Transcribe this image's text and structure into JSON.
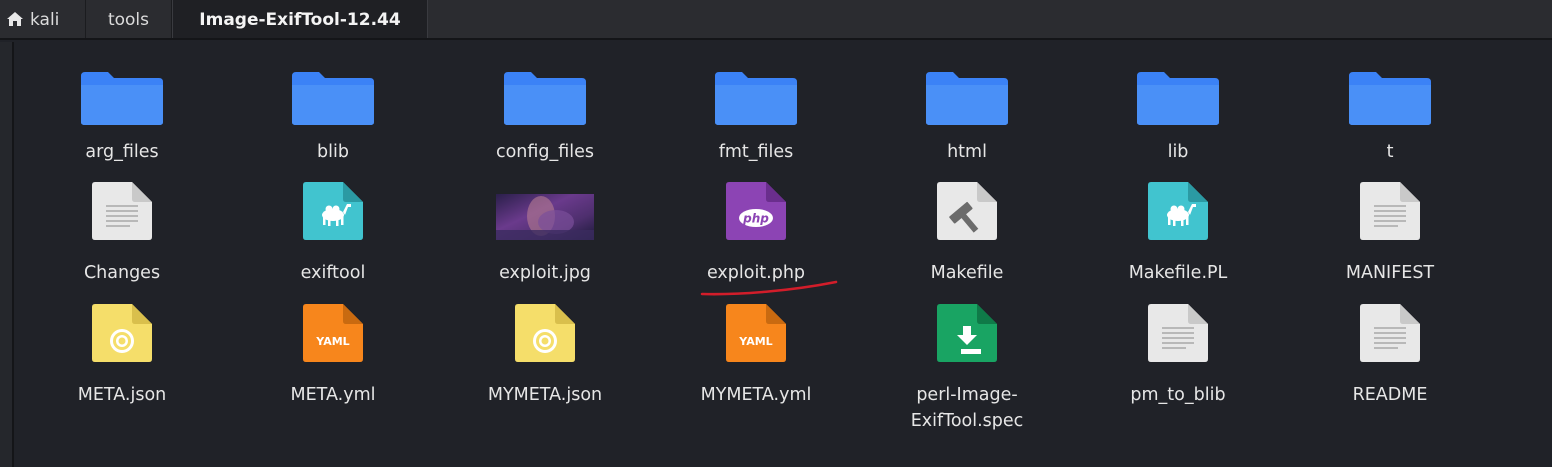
{
  "pathbar": {
    "crumbs": [
      {
        "label": "kali",
        "icon": "home-icon"
      },
      {
        "label": "tools"
      },
      {
        "label": "Image-ExifTool-12.44",
        "active": true
      }
    ]
  },
  "files": [
    {
      "name": "arg_files",
      "icon": "folder-icon"
    },
    {
      "name": "blib",
      "icon": "folder-icon"
    },
    {
      "name": "config_files",
      "icon": "folder-icon"
    },
    {
      "name": "fmt_files",
      "icon": "folder-icon"
    },
    {
      "name": "html",
      "icon": "folder-icon"
    },
    {
      "name": "lib",
      "icon": "folder-icon"
    },
    {
      "name": "t",
      "icon": "folder-icon"
    },
    {
      "name": "Changes",
      "icon": "text-file-icon"
    },
    {
      "name": "exiftool",
      "icon": "perl-file-icon"
    },
    {
      "name": "exploit.jpg",
      "icon": "image-thumbnail-icon"
    },
    {
      "name": "exploit.php",
      "icon": "php-file-icon",
      "annotated": true
    },
    {
      "name": "Makefile",
      "icon": "makefile-icon"
    },
    {
      "name": "Makefile.PL",
      "icon": "perl-file-icon"
    },
    {
      "name": "MANIFEST",
      "icon": "text-file-icon"
    },
    {
      "name": "META.json",
      "icon": "json-file-icon"
    },
    {
      "name": "META.yml",
      "icon": "yaml-file-icon"
    },
    {
      "name": "MYMETA.json",
      "icon": "json-file-icon"
    },
    {
      "name": "MYMETA.yml",
      "icon": "yaml-file-icon"
    },
    {
      "name": "perl-Image-ExifTool.spec",
      "label_lines": [
        "perl-Image-",
        "ExifTool.spec"
      ],
      "icon": "spec-package-icon"
    },
    {
      "name": "pm_to_blib",
      "icon": "text-file-icon"
    },
    {
      "name": "README",
      "icon": "text-file-icon"
    }
  ],
  "colors": {
    "folder": "#3b82f6",
    "perl": "#41c4cf",
    "php": "#8c44b4",
    "yaml": "#f7861c",
    "json": "#f5de6a",
    "spec": "#19a463",
    "annotation": "#d21d2a"
  }
}
